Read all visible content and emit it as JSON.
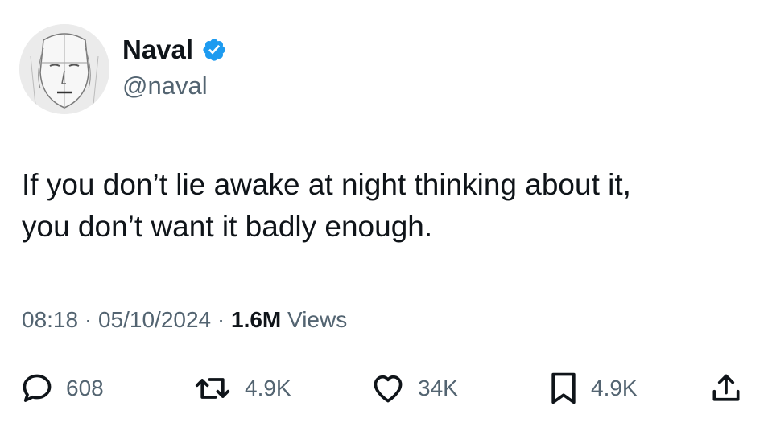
{
  "tweet": {
    "author": {
      "display_name": "Naval",
      "handle": "@naval",
      "verified": true,
      "verified_color": "#1d9bf0",
      "avatar_icon": "sketched-face-avatar"
    },
    "text_lines": [
      "If you don’t lie awake at night thinking about it,",
      "you don’t want it badly enough."
    ],
    "meta": {
      "time": "08:18",
      "separator": "·",
      "date": "05/10/2024",
      "views_count": "1.6M",
      "views_label": "Views"
    },
    "actions": {
      "reply": {
        "icon": "reply-icon",
        "count": "608"
      },
      "retweet": {
        "icon": "retweet-icon",
        "count": "4.9K"
      },
      "like": {
        "icon": "heart-icon",
        "count": "34K"
      },
      "bookmark": {
        "icon": "bookmark-icon",
        "count": "4.9K"
      },
      "share": {
        "icon": "share-icon"
      }
    }
  },
  "colors": {
    "text_primary": "#0f1419",
    "text_secondary": "#536471",
    "background": "#ffffff"
  }
}
